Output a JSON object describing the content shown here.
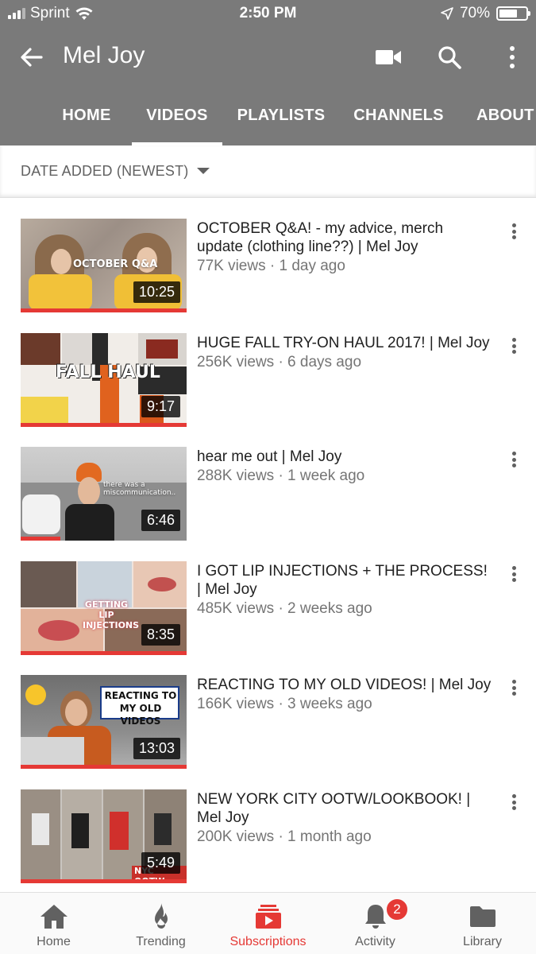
{
  "status_bar": {
    "carrier": "Sprint",
    "time": "2:50 PM",
    "battery": "70%",
    "battery_level": 0.7
  },
  "header": {
    "title": "Mel Joy",
    "icons": [
      "back-arrow-icon",
      "video-camera-icon",
      "search-icon",
      "more-vert-icon"
    ]
  },
  "tabs": [
    {
      "label": "HOME",
      "active": false
    },
    {
      "label": "VIDEOS",
      "active": true
    },
    {
      "label": "PLAYLISTS",
      "active": false
    },
    {
      "label": "CHANNELS",
      "active": false
    },
    {
      "label": "ABOUT",
      "active": false
    }
  ],
  "sort": {
    "label": "DATE ADDED (NEWEST)"
  },
  "videos": [
    {
      "title": "OCTOBER Q&A! - my advice, merch update (clothing line??) | Mel Joy",
      "meta": "77K views · 1 day ago",
      "duration": "10:25",
      "thumb_text": "OCTOBER Q&A"
    },
    {
      "title": "HUGE FALL TRY-ON HAUL 2017! | Mel Joy",
      "meta": "256K views · 6 days ago",
      "duration": "9:17",
      "thumb_text": "FALL HAUL"
    },
    {
      "title": "hear me out | Mel Joy",
      "meta": "288K views · 1 week ago",
      "duration": "6:46",
      "thumb_text": "there was a miscommunication.."
    },
    {
      "title": "I GOT LIP INJECTIONS + THE PROCESS! | Mel Joy",
      "meta": "485K views · 2 weeks ago",
      "duration": "8:35",
      "thumb_text": "GETTING LIP INJECTIONS"
    },
    {
      "title": "REACTING TO MY OLD VIDEOS! | Mel Joy",
      "meta": "166K views · 3 weeks ago",
      "duration": "13:03",
      "thumb_text": "REACTING TO MY OLD VIDEOS"
    },
    {
      "title": "NEW YORK CITY OOTW/LOOKBOOK! | Mel Joy",
      "meta": "200K views · 1 month ago",
      "duration": "5:49",
      "thumb_text": "NYC OOTW"
    }
  ],
  "bottom_nav": [
    {
      "label": "Home",
      "icon": "home-icon",
      "active": false
    },
    {
      "label": "Trending",
      "icon": "flame-icon",
      "active": false
    },
    {
      "label": "Subscriptions",
      "icon": "subscriptions-icon",
      "active": true
    },
    {
      "label": "Activity",
      "icon": "bell-icon",
      "active": false,
      "badge": "2"
    },
    {
      "label": "Library",
      "icon": "folder-icon",
      "active": false
    }
  ],
  "colors": {
    "header_bg": "#7a7a7a",
    "accent": "#e53935",
    "progress": "#e53935"
  }
}
